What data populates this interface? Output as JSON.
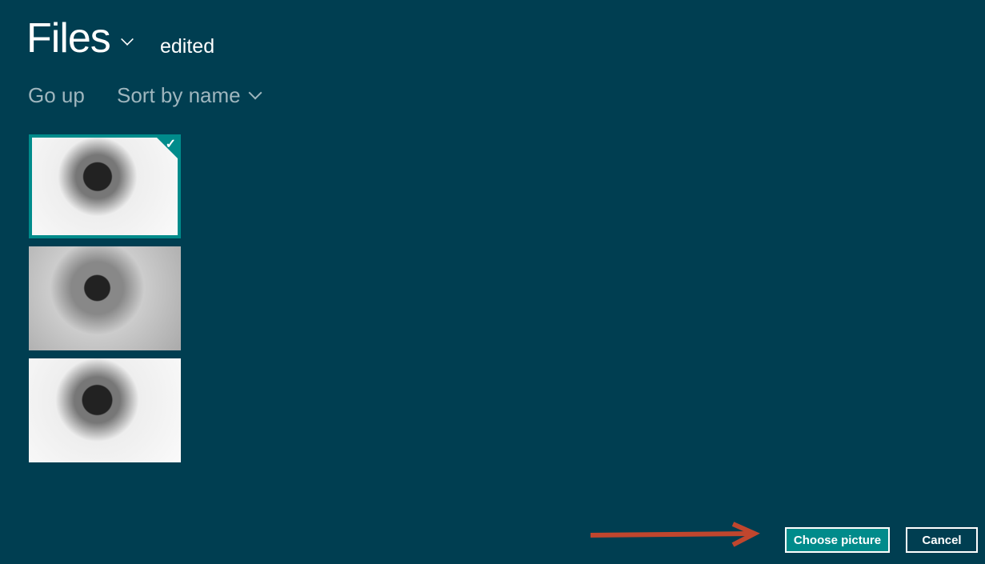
{
  "header": {
    "title": "Files",
    "folder": "edited"
  },
  "commands": {
    "go_up": "Go up",
    "sort": "Sort by name"
  },
  "files": [
    {
      "selected": true
    },
    {
      "selected": false
    },
    {
      "selected": false
    }
  ],
  "buttons": {
    "choose": "Choose picture",
    "cancel": "Cancel"
  },
  "colors": {
    "background": "#003e51",
    "accent": "#008b8b",
    "arrow": "#c0462e"
  }
}
